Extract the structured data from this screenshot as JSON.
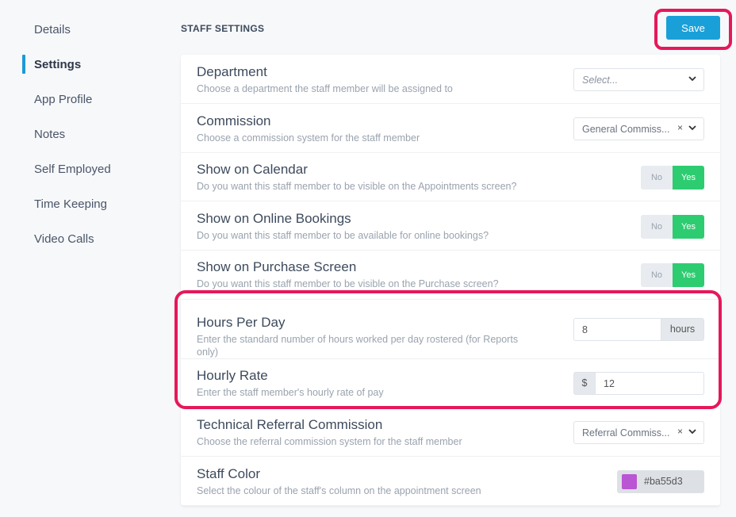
{
  "sidebar": {
    "items": [
      {
        "label": "Details"
      },
      {
        "label": "Settings"
      },
      {
        "label": "App Profile"
      },
      {
        "label": "Notes"
      },
      {
        "label": "Self Employed"
      },
      {
        "label": "Time Keeping"
      },
      {
        "label": "Video Calls"
      }
    ],
    "active": "Settings"
  },
  "header": {
    "title": "STAFF SETTINGS",
    "save_label": "Save"
  },
  "rows": {
    "department": {
      "title": "Department",
      "desc": "Choose a department the staff member will be assigned to",
      "placeholder": "Select..."
    },
    "commission": {
      "title": "Commission",
      "desc": "Choose a commission system for the staff member",
      "value": "General Commiss...",
      "clear": "×"
    },
    "calendar": {
      "title": "Show on Calendar",
      "desc": "Do you want this staff member to be visible on the Appointments screen?",
      "no": "No",
      "yes": "Yes",
      "selected": "Yes"
    },
    "online": {
      "title": "Show on Online Bookings",
      "desc": "Do you want this staff member to be available for online bookings?",
      "no": "No",
      "yes": "Yes",
      "selected": "Yes"
    },
    "purchase": {
      "title": "Show on Purchase Screen",
      "desc": "Do you want this staff member to be visible on the Purchase screen?",
      "no": "No",
      "yes": "Yes",
      "selected": "Yes"
    },
    "hours": {
      "title": "Hours Per Day",
      "desc_line1": "Enter the standard number of hours worked per day rostered (for Reports",
      "desc_line2": "only)",
      "value": "8",
      "unit": "hours"
    },
    "rate": {
      "title": "Hourly Rate",
      "desc": "Enter the staff member's hourly rate of pay",
      "currency": "$",
      "value": "12"
    },
    "referral": {
      "title": "Technical Referral Commission",
      "desc": "Choose the referral commission system for the staff member",
      "value": "Referral Commiss...",
      "clear": "×"
    },
    "color": {
      "title": "Staff Color",
      "desc": "Select the colour of the staff's column on the appointment screen",
      "value": "#ba55d3"
    }
  },
  "colors": {
    "accent": "#1aa0d8",
    "toggle_on": "#2ecc71",
    "highlight": "#e6185a",
    "staff_color": "#ba55d3"
  }
}
